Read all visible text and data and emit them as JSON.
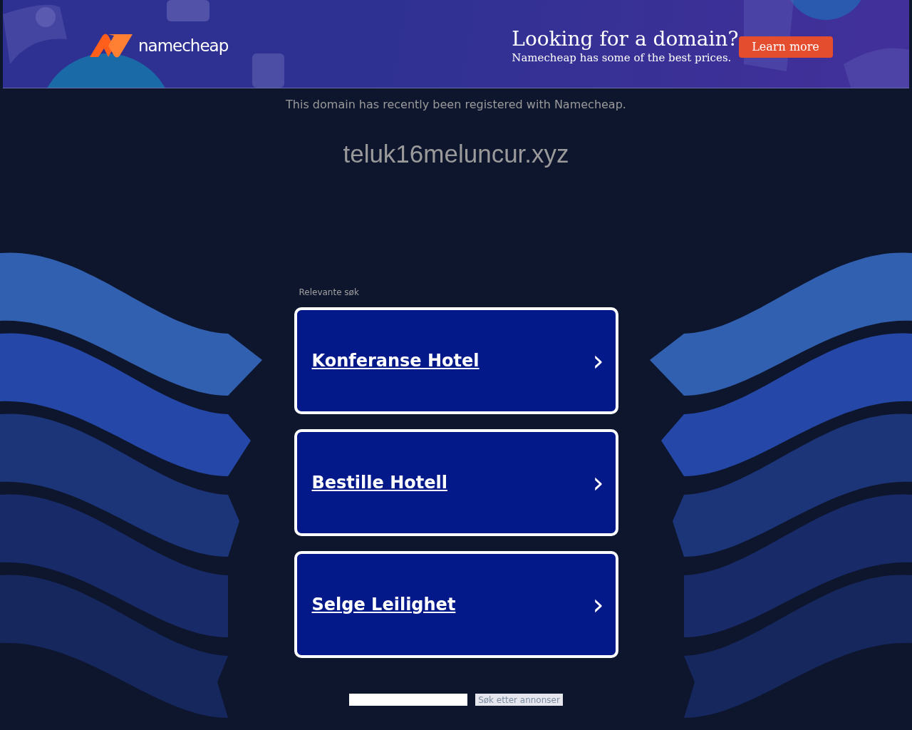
{
  "banner": {
    "logo": "namecheap",
    "headline": "Looking for a domain?",
    "subline": "Namecheap has some of the best prices.",
    "button": "Learn more"
  },
  "notice": "This domain has recently been registered with Namecheap.",
  "domain": "teluk16meluncur.xyz",
  "related": {
    "label": "Relevante søk",
    "links": [
      {
        "text": "Konferanse Hotel",
        "arrow": "›"
      },
      {
        "text": "Bestille Hotell",
        "arrow": "›"
      },
      {
        "text": "Selge Leilighet",
        "arrow": "›"
      }
    ]
  },
  "search": {
    "button": "Søk etter annonser"
  }
}
